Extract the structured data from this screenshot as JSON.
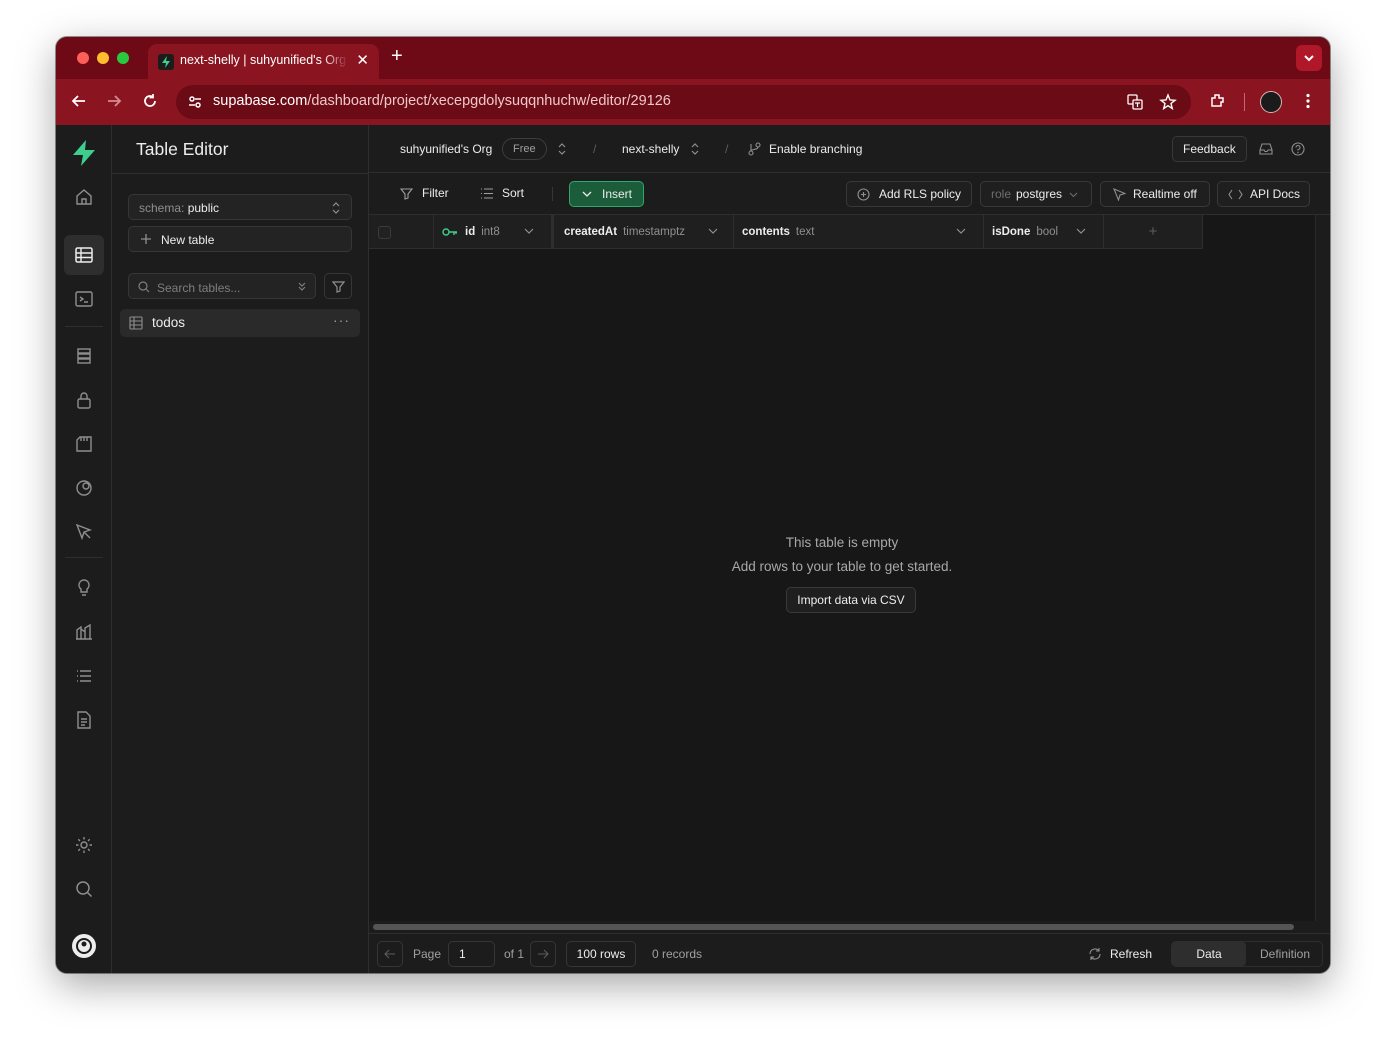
{
  "browser": {
    "tab_title": "next-shelly | suhyunified's Org",
    "new_tab": "+",
    "url_host": "supabase.com",
    "url_path": "/dashboard/project/xecepgdolysuqqnhuchw/editor/29126",
    "theme_color": "#8a1521"
  },
  "sidebar": {
    "title": "Table Editor",
    "schema_label": "schema:",
    "schema_value": "public",
    "new_table": "New table",
    "search_placeholder": "Search tables...",
    "tables": [
      {
        "name": "todos",
        "more": "···"
      }
    ]
  },
  "topbar": {
    "org": "suhyunified's Org",
    "plan": "Free",
    "project": "next-shelly",
    "branching": "Enable branching",
    "feedback": "Feedback"
  },
  "actions": {
    "filter": "Filter",
    "sort": "Sort",
    "insert": "Insert",
    "add_rls": "Add RLS policy",
    "role_label": "role",
    "role_value": "postgres",
    "realtime": "Realtime off",
    "api_docs": "API Docs",
    "accent": "#3ecf8e"
  },
  "grid": {
    "columns": [
      {
        "name": "id",
        "type": "int8",
        "primary_key": true
      },
      {
        "name": "createdAt",
        "type": "timestamptz"
      },
      {
        "name": "contents",
        "type": "text"
      },
      {
        "name": "isDone",
        "type": "bool"
      }
    ],
    "add_column": "+",
    "empty_title": "This table is empty",
    "empty_sub": "Add rows to your table to get started.",
    "import_csv": "Import data via CSV"
  },
  "footer": {
    "page_label": "Page",
    "page_value": "1",
    "of_label": "of 1",
    "rows_per_page": "100 rows",
    "records": "0 records",
    "refresh": "Refresh",
    "tab_data": "Data",
    "tab_definition": "Definition"
  }
}
